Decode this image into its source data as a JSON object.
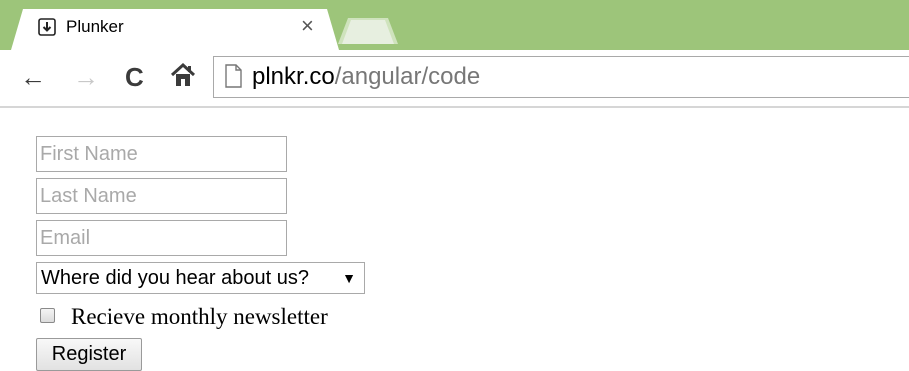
{
  "browser": {
    "tab": {
      "title": "Plunker",
      "close_glyph": "×",
      "favicon": "download-arrow-icon"
    },
    "toolbar": {
      "back_glyph": "←",
      "forward_glyph": "→",
      "reload_glyph": "C",
      "home_icon": "home-icon"
    },
    "address_bar": {
      "host": "plnkr.co",
      "path": "/angular/code",
      "page_icon": "page-icon"
    },
    "colors": {
      "tabstrip": "#9dc57a"
    }
  },
  "form": {
    "first_name": {
      "placeholder": "First Name",
      "value": ""
    },
    "last_name": {
      "placeholder": "Last Name",
      "value": ""
    },
    "email": {
      "placeholder": "Email",
      "value": ""
    },
    "source_select": {
      "selected": "Where did you hear about us?",
      "arrow": "▼"
    },
    "newsletter": {
      "label": "Recieve monthly newsletter",
      "checked": false
    },
    "register_label": "Register"
  }
}
